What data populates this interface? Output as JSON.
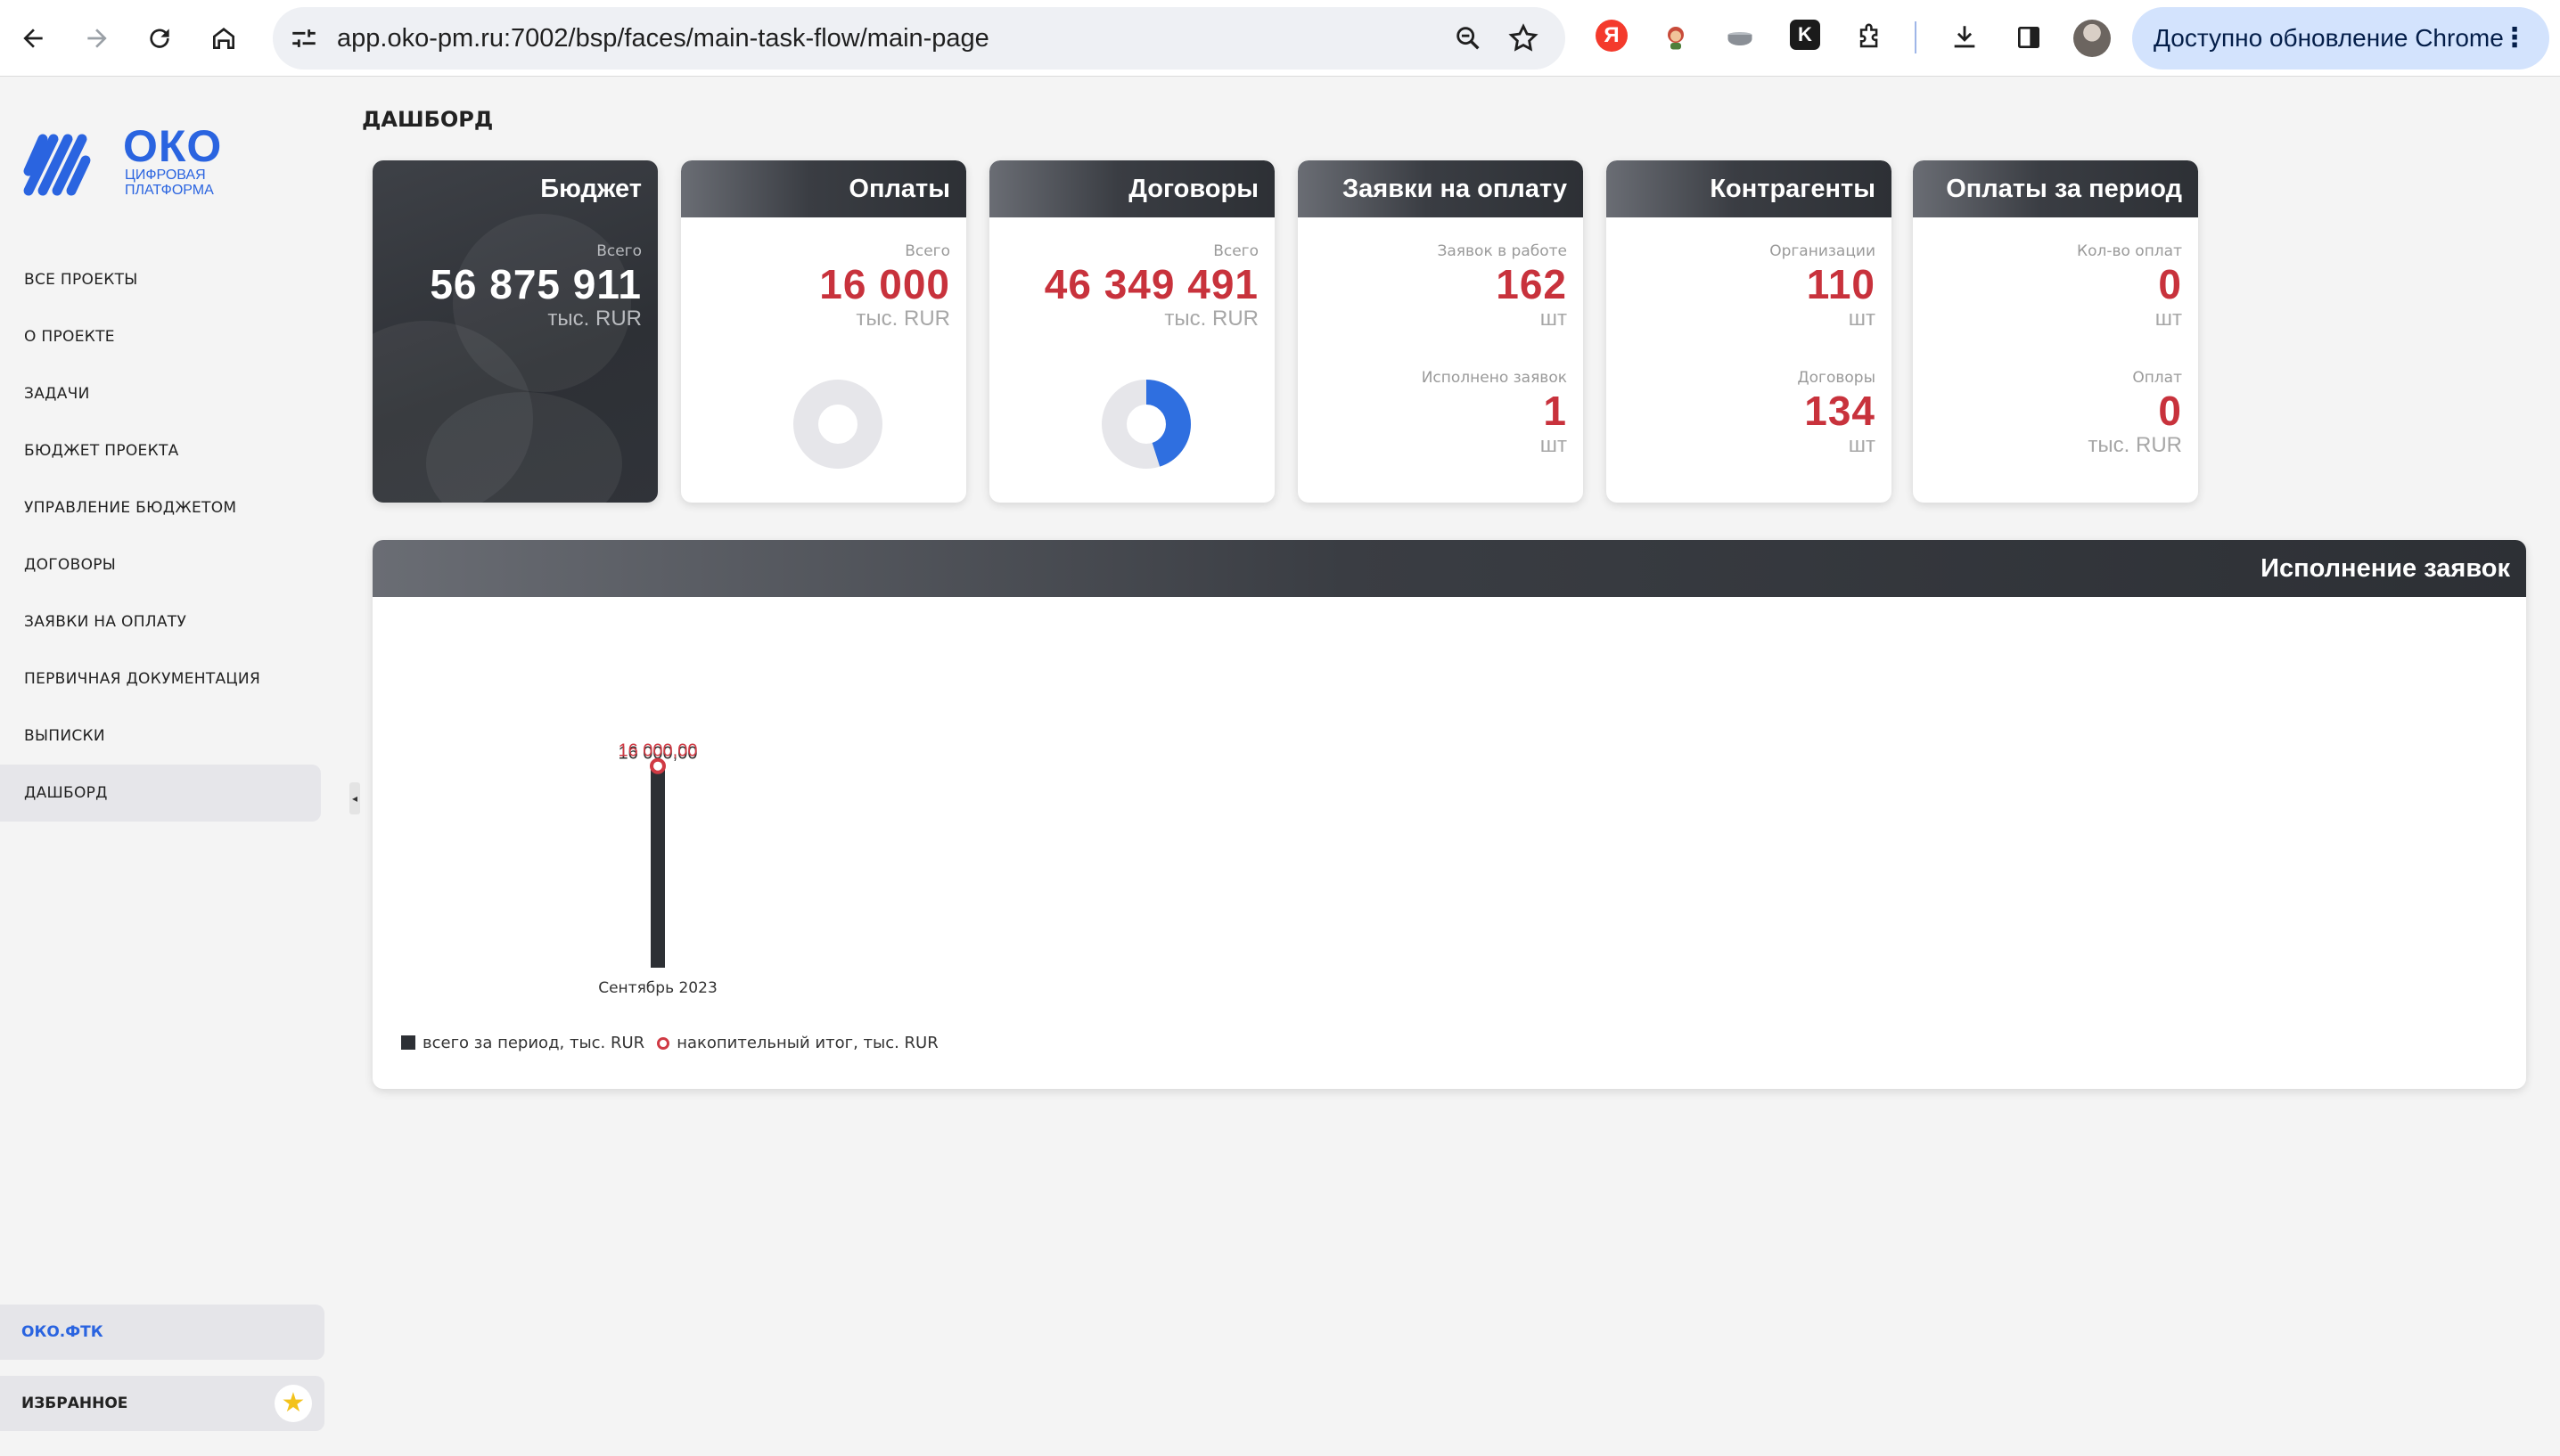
{
  "browser": {
    "url": "app.oko-pm.ru:7002/bsp/faces/main-task-flow/main-page",
    "update_label": "Доступно обновление Chrome",
    "ext_ya_letter": "Я",
    "ext_k_letter": "K"
  },
  "sidebar": {
    "logo_title": "ОКО",
    "logo_sub_1": "цифровая",
    "logo_sub_2": "платформа",
    "items": [
      {
        "label": "ВСЕ ПРОЕКТЫ"
      },
      {
        "label": "О ПРОЕКТЕ"
      },
      {
        "label": "ЗАДАЧИ"
      },
      {
        "label": "БЮДЖЕТ ПРОЕКТА"
      },
      {
        "label": "УПРАВЛЕНИЕ БЮДЖЕТОМ"
      },
      {
        "label": "ДОГОВОРЫ"
      },
      {
        "label": "ЗАЯВКИ НА ОПЛАТУ"
      },
      {
        "label": "ПЕРВИЧНАЯ ДОКУМЕНТАЦИЯ"
      },
      {
        "label": "ВЫПИСКИ"
      },
      {
        "label": "ДАШБОРД",
        "active": true
      }
    ],
    "oko_ftk": "ОКО.ФТК",
    "favorites": "ИЗБРАННОЕ"
  },
  "page": {
    "title": "ДАШБОРД"
  },
  "cards": {
    "budget": {
      "title": "Бюджет",
      "label": "Всего",
      "value": "56 875 911",
      "unit": "тыс. RUR"
    },
    "payments": {
      "title": "Оплаты",
      "label": "Всего",
      "value": "16 000",
      "unit": "тыс. RUR",
      "donut_fraction": 0
    },
    "contracts": {
      "title": "Договоры",
      "label": "Всего",
      "value": "46 349 491",
      "unit": "тыс. RUR",
      "donut_fraction": 0.45
    },
    "requests": {
      "title": "Заявки на оплату",
      "label1": "Заявок в работе",
      "value1": "162",
      "unit1": "шт",
      "label2": "Исполнено заявок",
      "value2": "1",
      "unit2": "шт"
    },
    "counterparties": {
      "title": "Контрагенты",
      "label1": "Организации",
      "value1": "110",
      "unit1": "шт",
      "label2": "Договоры",
      "value2": "134",
      "unit2": "шт"
    },
    "period": {
      "title": "Оплаты за период",
      "label1": "Кол-во оплат",
      "value1": "0",
      "unit1": "шт",
      "label2": "Оплат",
      "value2": "0",
      "unit2": "тыс. RUR"
    }
  },
  "colors": {
    "accent_red": "#c8323c",
    "brand_blue": "#2a64e0",
    "donut_blue": "#2f6fe0",
    "dark": "#2d3035"
  },
  "panel": {
    "title": "Исполнение заявок",
    "legend_bar": "всего за период, тыс. RUR",
    "legend_line": "накопительный итог, тыс. RUR"
  },
  "chart_data": {
    "type": "bar",
    "categories": [
      "Сентябрь 2023"
    ],
    "series": [
      {
        "name": "всего за период, тыс. RUR",
        "kind": "bar",
        "values": [
          16000
        ],
        "labels": [
          "16 000,00"
        ]
      },
      {
        "name": "накопительный итог, тыс. RUR",
        "kind": "line",
        "values": [
          16000
        ],
        "labels": [
          "16 000,00"
        ]
      }
    ],
    "ylim": [
      0,
      28000
    ],
    "grid": false,
    "legend": "bottom-left"
  }
}
